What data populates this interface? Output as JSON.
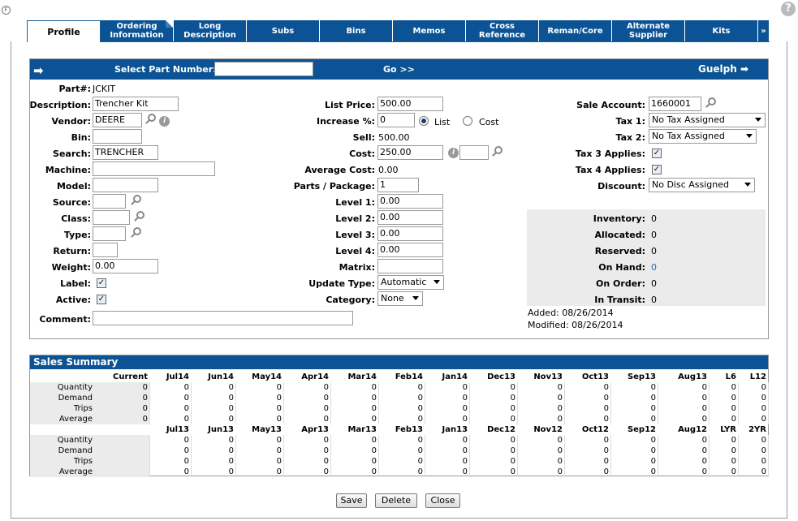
{
  "tabs": [
    {
      "label": "Profile",
      "active": true
    },
    {
      "label": "Ordering Information"
    },
    {
      "label": "Long Description"
    },
    {
      "label": "Subs"
    },
    {
      "label": "Bins"
    },
    {
      "label": "Memos"
    },
    {
      "label": "Cross Reference"
    },
    {
      "label": "Reman/Core"
    },
    {
      "label": "Alternate Supplier"
    },
    {
      "label": "Kits"
    },
    {
      "label": "»"
    }
  ],
  "header": {
    "select_label": "Select Part Number:",
    "go_label": "Go >>",
    "location": "Guelph"
  },
  "left": {
    "part_label": "Part#:",
    "part_value": "JCKIT",
    "description_label": "Description:",
    "description_value": "Trencher Kit",
    "vendor_label": "Vendor:",
    "vendor_value": "DEERE",
    "bin_label": "Bin:",
    "bin_value": "",
    "search_label": "Search:",
    "search_value": "TRENCHER",
    "machine_label": "Machine:",
    "machine_value": "",
    "model_label": "Model:",
    "model_value": "",
    "source_label": "Source:",
    "source_value": "",
    "class_label": "Class:",
    "class_value": "",
    "type_label": "Type:",
    "type_value": "",
    "return_label": "Return:",
    "return_value": "",
    "weight_label": "Weight:",
    "weight_value": "0.00",
    "label_label": "Label:",
    "label_checked": true,
    "active_label": "Active:",
    "active_checked": true,
    "comment_label": "Comment:",
    "comment_value": ""
  },
  "middle": {
    "list_price_label": "List Price:",
    "list_price_value": "500.00",
    "increase_label": "Increase %:",
    "increase_value": "0",
    "radio_list": "List",
    "radio_cost": "Cost",
    "sell_label": "Sell:",
    "sell_value": "500.00",
    "cost_label": "Cost:",
    "cost_value": "250.00",
    "avg_cost_label": "Average Cost:",
    "avg_cost_value": "0.00",
    "parts_pkg_label": "Parts / Package:",
    "parts_pkg_value": "1",
    "level1_label": "Level 1:",
    "level1_value": "0.00",
    "level2_label": "Level 2:",
    "level2_value": "0.00",
    "level3_label": "Level 3:",
    "level3_value": "0.00",
    "level4_label": "Level 4:",
    "level4_value": "0.00",
    "matrix_label": "Matrix:",
    "matrix_value": "",
    "update_type_label": "Update Type:",
    "update_type_value": "Automatic",
    "category_label": "Category:",
    "category_value": "None"
  },
  "right": {
    "sale_account_label": "Sale Account:",
    "sale_account_value": "1660001",
    "tax1_label": "Tax 1:",
    "tax1_value": "No Tax Assigned",
    "tax2_label": "Tax 2:",
    "tax2_value": "No Tax Assigned",
    "tax3_label": "Tax 3 Applies:",
    "tax3_checked": true,
    "tax4_label": "Tax 4 Applies:",
    "tax4_checked": true,
    "discount_label": "Discount:",
    "discount_value": "No Disc Assigned"
  },
  "inventory": [
    {
      "label": "Inventory:",
      "value": "0"
    },
    {
      "label": "Allocated:",
      "value": "0"
    },
    {
      "label": "Reserved:",
      "value": "0"
    },
    {
      "label": "On Hand:",
      "value": "0",
      "link": true
    },
    {
      "label": "On Order:",
      "value": "0"
    },
    {
      "label": "In Transit:",
      "value": "0"
    }
  ],
  "added": "Added: 08/26/2014",
  "modified": "Modified: 08/26/2014",
  "sales": {
    "title": "Sales Summary",
    "row_labels": [
      "Quantity",
      "Demand",
      "Trips",
      "Average"
    ],
    "header1": [
      "Current",
      "Jul14",
      "Jun14",
      "May14",
      "Apr14",
      "Mar14",
      "Feb14",
      "Jan14",
      "Dec13",
      "Nov13",
      "Oct13",
      "Sep13",
      "Aug13",
      "L6",
      "L12"
    ],
    "block1": [
      [
        "0",
        "0",
        "0",
        "0",
        "0",
        "0",
        "0",
        "0",
        "0",
        "0",
        "0",
        "0",
        "0",
        "0",
        "0"
      ],
      [
        "0",
        "0",
        "0",
        "0",
        "0",
        "0",
        "0",
        "0",
        "0",
        "0",
        "0",
        "0",
        "0",
        "0",
        "0"
      ],
      [
        "0",
        "0",
        "0",
        "0",
        "0",
        "0",
        "0",
        "0",
        "0",
        "0",
        "0",
        "0",
        "0",
        "0",
        "0"
      ],
      [
        "0",
        "0",
        "0",
        "0",
        "0",
        "0",
        "0",
        "0",
        "0",
        "0",
        "0",
        "0",
        "0",
        "0",
        "0"
      ]
    ],
    "header2": [
      "",
      "Jul13",
      "Jun13",
      "May13",
      "Apr13",
      "Mar13",
      "Feb13",
      "Jan13",
      "Dec12",
      "Nov12",
      "Oct12",
      "Sep12",
      "Aug12",
      "LYR",
      "2YR"
    ],
    "block2": [
      [
        "",
        "0",
        "0",
        "0",
        "0",
        "0",
        "0",
        "0",
        "0",
        "0",
        "0",
        "0",
        "0",
        "0",
        "0"
      ],
      [
        "",
        "0",
        "0",
        "0",
        "0",
        "0",
        "0",
        "0",
        "0",
        "0",
        "0",
        "0",
        "0",
        "0",
        "0"
      ],
      [
        "",
        "0",
        "0",
        "0",
        "0",
        "0",
        "0",
        "0",
        "0",
        "0",
        "0",
        "0",
        "0",
        "0",
        "0"
      ],
      [
        "",
        "0",
        "0",
        "0",
        "0",
        "0",
        "0",
        "0",
        "0",
        "0",
        "0",
        "0",
        "0",
        "0",
        "0"
      ]
    ]
  },
  "buttons": {
    "save": "Save",
    "delete": "Delete",
    "close": "Close"
  },
  "icons": {
    "corner": "F",
    "help": "?",
    "info": "i",
    "check": "✓"
  }
}
